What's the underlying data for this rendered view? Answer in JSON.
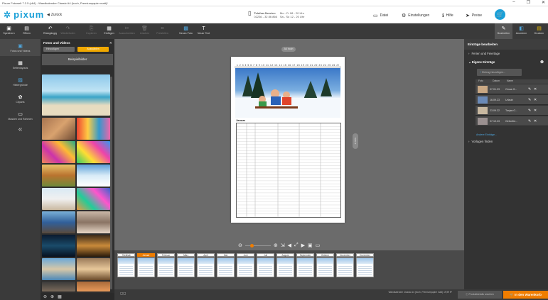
{
  "window": {
    "title": "Pixum Fotowelt 7.2.5 (x64) - Wandkalender Classic A4 (hoch, Premiumpapier matt)*",
    "minimize": "–",
    "maximize": "❐",
    "close": "✕"
  },
  "header": {
    "logo": "pixum",
    "back_label": "Zurück",
    "service_title": "Telefon-Service:",
    "service_phone": "02236 - 32 86 866",
    "service_hours1": "Mo - Fr 08 - 20 Uhr",
    "service_hours2": "Sa - So 12 - 20 Uhr",
    "nav": [
      {
        "label": "Datei",
        "icon": "folder-icon"
      },
      {
        "label": "Einstellungen",
        "icon": "gear-icon"
      },
      {
        "label": "Hilfe",
        "icon": "info-icon"
      },
      {
        "label": "Preise",
        "icon": "tag-icon"
      }
    ],
    "brand_color": "#1aa0d8"
  },
  "toolbar": {
    "left": [
      {
        "label": "Speichern",
        "icon": "save-icon",
        "enabled": true
      },
      {
        "label": "Öffnen",
        "icon": "open-icon",
        "enabled": true
      },
      {
        "label": "Rückgängig",
        "icon": "undo-icon",
        "enabled": true
      },
      {
        "label": "Wiederholen",
        "icon": "redo-icon",
        "enabled": false
      },
      {
        "label": "Kopieren",
        "icon": "copy-icon",
        "enabled": false
      },
      {
        "label": "Einfügen",
        "icon": "paste-icon",
        "enabled": true
      },
      {
        "label": "Ausschneiden",
        "icon": "cut-icon",
        "enabled": false
      },
      {
        "label": "Löschen",
        "icon": "delete-icon",
        "enabled": false
      },
      {
        "label": "Freistellen",
        "icon": "crop-icon",
        "enabled": false
      },
      {
        "label": "Neues Foto",
        "icon": "add-photo-icon",
        "enabled": true
      },
      {
        "label": "Neuer Text",
        "icon": "add-text-icon",
        "enabled": true
      }
    ],
    "right": [
      {
        "label": "Bearbeiten",
        "icon": "edit-icon",
        "active": true
      },
      {
        "label": "Anordnen",
        "icon": "arrange-icon",
        "active": false
      },
      {
        "label": "Drucken",
        "icon": "print-icon",
        "active": false
      }
    ]
  },
  "leftnav": [
    {
      "label": "Fotos und Videos",
      "icon": "photos-icon",
      "active": true
    },
    {
      "label": "Seitenlayouts",
      "icon": "layout-icon",
      "active": false
    },
    {
      "label": "Hintergründe",
      "icon": "background-icon",
      "active": false
    },
    {
      "label": "Cliparts",
      "icon": "clipart-icon",
      "active": false
    },
    {
      "label": "Masken und Rahmen",
      "icon": "mask-icon",
      "active": false
    }
  ],
  "photos": {
    "title": "Fotos und Videos",
    "close": "×",
    "btn_add": "Hinzufügen",
    "btn_choose": "Auswählen",
    "tab": "Beispielbilder"
  },
  "canvas": {
    "size_label": "A4 hoch",
    "side_label": "Seite 2",
    "month_title": "Januar",
    "calendar_days": "1 2 3 4 5 6 7 8 9 10 11 12 13 14 15 16 17 18 19 20 21 22 23 24 25 26 27 28 29 30 31"
  },
  "months": [
    {
      "label": "Titelblatt",
      "selected": false
    },
    {
      "label": "Januar",
      "selected": true
    },
    {
      "label": "Februar",
      "selected": false
    },
    {
      "label": "März",
      "selected": false
    },
    {
      "label": "April",
      "selected": false
    },
    {
      "label": "Mai",
      "selected": false
    },
    {
      "label": "Juni",
      "selected": false
    },
    {
      "label": "Juli",
      "selected": false
    },
    {
      "label": "August",
      "selected": false
    },
    {
      "label": "September",
      "selected": false
    },
    {
      "label": "Oktober",
      "selected": false
    },
    {
      "label": "November",
      "selected": false
    },
    {
      "label": "Dezember",
      "selected": false
    }
  ],
  "right": {
    "title": "Einträge bearbeiten",
    "sec_holidays": "Ferien und Feiertage",
    "sec_own": "Eigene Einträge",
    "add_btn": "Eintrag hinzufügen...",
    "col_photo": "Foto",
    "col_date": "Datum",
    "col_name": "Name",
    "entries": [
      {
        "date": "07.01.23",
        "name": "Omas G..."
      },
      {
        "date": "16.09.23",
        "name": "Urlaub"
      },
      {
        "date": "23.09.22",
        "name": "Tanjas G..."
      },
      {
        "date": "07.10.23",
        "name": "Geburtst..."
      }
    ],
    "link": "Andere Einträge...",
    "sec_templates": "Vorlagen finden"
  },
  "footer": {
    "info": "Wandkalender Classic A4 (hoch, Premiumpapier matt) 19,99 €*",
    "grey_btn": "Produktdetails ansehen",
    "cart_btn": "In den Warenkorb",
    "accent": "#f07d00"
  }
}
